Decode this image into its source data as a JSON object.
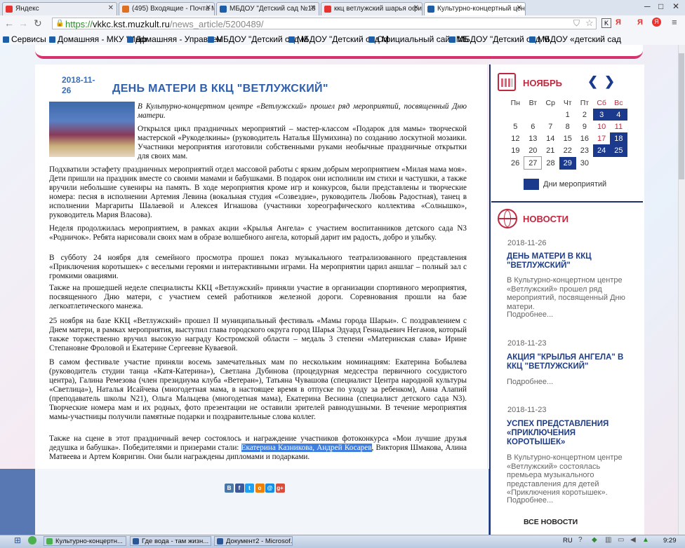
{
  "browser": {
    "tabs": [
      {
        "label": "Яндекс",
        "color": "#e8322f",
        "active": false
      },
      {
        "label": "(495) Входящие - Почта Ma",
        "color": "#e07020",
        "active": false
      },
      {
        "label": "МБДОУ \"Детский сад №18",
        "color": "#1e5ea8",
        "active": false
      },
      {
        "label": "ккц ветлужский шарья офи",
        "color": "#e8322f",
        "active": false
      },
      {
        "label": "Культурно-концертный цен",
        "color": "#1e5ea8",
        "active": true
      }
    ],
    "url_scheme": "https://",
    "url_host": "vkkc.kst.muzkult.ru",
    "url_path": "/news_article/5200489/",
    "bookmarks": [
      "Сервисы",
      "Домашняя - МКУ \"Инф",
      "Домашняя - Управлен",
      "МБДОУ \"Детский сад М",
      "МБДОУ \"Детский сад М",
      "Официальный сайт МБ",
      "МБДОУ \"Детский сад М",
      "МБДОУ «детский сад"
    ]
  },
  "article": {
    "date": "2018-11-26",
    "title": "ДЕНЬ МАТЕРИ В ККЦ \"ВЕТЛУЖСКИЙ\"",
    "lead": "В Культурно-концертном центре «Ветлужский» прошел ряд мероприятий, посвященный Дню матери.",
    "p1": "Открылся цикл праздничных мероприятий – мастер-классом «Подарок для мамы» творческой мастерской «Рукоделкины» (руководитель Наталья Шумихина) по созданию лоскутной мозаики. Участники мероприятия изготовили собственными руками необычные праздничные открытки для своих мам.",
    "p2": "Подхватили эстафету праздничных мероприятий отдел массовой работы с ярким добрым мероприятием «Милая мама моя». Дети пришли на праздник вместе со своими мамами и бабушками. В подарок они исполнили им стихи и частушки, а также вручили небольшие сувениры на память. В ходе мероприятия кроме игр и конкурсов, были представлены и творческие номера: песня в исполнении Артемия Левина (вокальная студия «Созвездие», руководитель Любовь Радостная), танец в исполнении Маргариты Шалаевой и Алексея Игнашова (участники хореографического коллектива «Солнышко», руководитель Мария Власова).",
    "p3": "Неделя продолжилась мероприятием, в рамках акции «Крылья Ангела» с участием воспитанников детского сада N3 «Родничок». Ребята нарисовали своих мам в образе волшебного ангела, который дарит им радость, добро и улыбку.",
    "p4": "В субботу 24 ноября для семейного просмотра прошел показ музыкального театрализованного представления «Приключения коротышек» с веселыми героями и интерактивными играми. На мероприятии царил аншлаг – полный зал с громкими овациями.",
    "p5": "Также на прошедшей неделе специалисты ККЦ «Ветлужский» приняли участие в организации спортивного мероприятия, посвященного Дню матери, с участием семей работников железной дороги. Соревнования прошли на базе легкоатлетического манежа.",
    "p6": "25 ноября на базе ККЦ «Ветлужский» прошел II муниципальный фестиваль «Мамы города Шарьи». С поздравлением с Днем матери, в рамках мероприятия, выступил глава городского округа город Шарья Эдуард Геннадьевич Неганов, который также торжественно вручил высокую награду Костромской области – медаль 3 степени «Материнская слава» Ирине Степановне Фроловой и Екатерине Сергеевне Куваевой.",
    "p7": "В самом фестивале участие приняли восемь замечательных мам по нескольким номинациям: Екатерина Бобылева (руководитель студии танца «Катя-Катерина»), Светлана Дубинова (процедурная медсестра первичного сосудистого центра), Галина Ремезова (член президиума клуба «Ветеран»), Татьяна Чувашова (специалист Центра народной культуры «Светлица»), Наталья Исайчева (многодетная мама, в настоящее время в отпуске по уходу за ребенком), Анна Алапий (преподаватель школы N21), Ольга Мальцева (многодетная мама), Екатерина Веснина (специалист детского сада N3). Творческие номера мам и их родных, фото презентации не оставили зрителей равнодушными. В течение мероприятия мамы-участницы получили памятные подарки и поздравительные слова коллег.",
    "p8a": "Также на сцене в этот праздничный вечер состоялось и награждение участников фотоконкурса «Мои лучшие друзья дедушка и бабушка». Победителями и призерами стали: ",
    "p8hl": "Екатерина Казникова, Андрей Косарев",
    "p8b": ", Виктория Шмакова, Алина Матвеева и Артем Ковригин. Они были награждены дипломами и подарками."
  },
  "share": [
    {
      "label": "В",
      "color": "#4a76a8"
    },
    {
      "label": "f",
      "color": "#3b5998"
    },
    {
      "label": "t",
      "color": "#1da1f2"
    },
    {
      "label": "о",
      "color": "#ee8208"
    },
    {
      "label": "@",
      "color": "#168de2"
    },
    {
      "label": "g+",
      "color": "#dd4b39"
    }
  ],
  "calendar": {
    "month": "НОЯБРЬ",
    "weekdays": [
      "Пн",
      "Вт",
      "Ср",
      "Чт",
      "Пт",
      "Сб",
      "Вс"
    ],
    "weeks": [
      [
        "",
        "",
        "",
        "1",
        "2",
        "3",
        "4"
      ],
      [
        "5",
        "6",
        "7",
        "8",
        "9",
        "10",
        "11"
      ],
      [
        "12",
        "13",
        "14",
        "15",
        "16",
        "17",
        "18"
      ],
      [
        "19",
        "20",
        "21",
        "22",
        "23",
        "24",
        "25"
      ],
      [
        "26",
        "27",
        "28",
        "29",
        "30",
        "",
        ""
      ]
    ],
    "event_days": [
      "3",
      "4",
      "18",
      "24",
      "25",
      "29"
    ],
    "today": "27",
    "legend": "Дни мероприятий"
  },
  "news": {
    "heading": "НОВОСТИ",
    "items": [
      {
        "date": "2018-11-26",
        "title": "ДЕНЬ МАТЕРИ В ККЦ \"ВЕТЛУЖСКИЙ\"",
        "text": "В Культурно-концертном центре «Ветлужский» прошел ряд мероприятий, посвященный Дню матери.",
        "more": "Подробнее..."
      },
      {
        "date": "2018-11-23",
        "title": "АКЦИЯ \"КРЫЛЬЯ АНГЕЛА\" В ККЦ \"ВЕТЛУЖСКИЙ\"",
        "text": "",
        "more": "Подробнее..."
      },
      {
        "date": "2018-11-23",
        "title": "УСПЕХ ПРЕДСТАВЛЕНИЯ «ПРИКЛЮЧЕНИЯ КОРОТЫШЕК»",
        "text": "В Культурно-концертном центре «Ветлужский» состоялась премьера музыкального представления для детей «Приключения коротышек».",
        "more": "Подробнее..."
      }
    ],
    "all_news": "ВСЕ НОВОСТИ"
  },
  "taskbar": {
    "items": [
      {
        "label": "Культурно-концертн...",
        "color": "#4caf50"
      },
      {
        "label": "Где вода - там жизн...",
        "color": "#2b5797"
      },
      {
        "label": "Документ2 - Microsof...",
        "color": "#2b5797"
      }
    ],
    "lang": "RU",
    "time": "9:29"
  }
}
